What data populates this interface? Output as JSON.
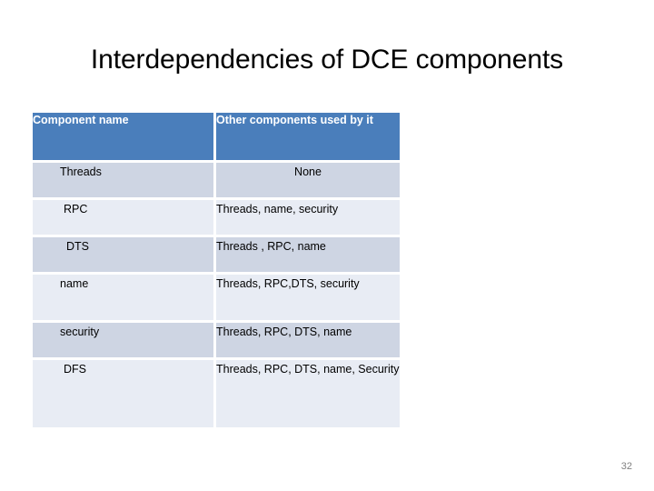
{
  "slide": {
    "title": "Interdependencies of DCE components",
    "page_number": "32",
    "colors": {
      "header_background": "#4a7ebb",
      "header_text": "#ffffff",
      "row_dark": "#ced5e3",
      "row_light": "#e8ecf4",
      "body_text": "#000000",
      "page_number_text": "#808080",
      "slide_background": "#ffffff"
    }
  },
  "table": {
    "headers": {
      "component_name": "Component name",
      "other_components": "Other components used by it"
    },
    "rows": [
      {
        "component": "Threads",
        "depends_on": "None",
        "shade": "dark",
        "depends_align": "center"
      },
      {
        "component": "RPC",
        "depends_on": "Threads, name, security",
        "shade": "light",
        "depends_align": "left"
      },
      {
        "component": "DTS",
        "depends_on": "Threads , RPC, name",
        "shade": "dark",
        "depends_align": "left"
      },
      {
        "component": "name",
        "depends_on": "Threads, RPC,DTS, security",
        "shade": "light",
        "depends_align": "left"
      },
      {
        "component": "security",
        "depends_on": "Threads, RPC, DTS, name",
        "shade": "dark",
        "depends_align": "left"
      },
      {
        "component": "DFS",
        "depends_on": "Threads, RPC, DTS, name, Security",
        "shade": "light",
        "depends_align": "left"
      }
    ]
  }
}
